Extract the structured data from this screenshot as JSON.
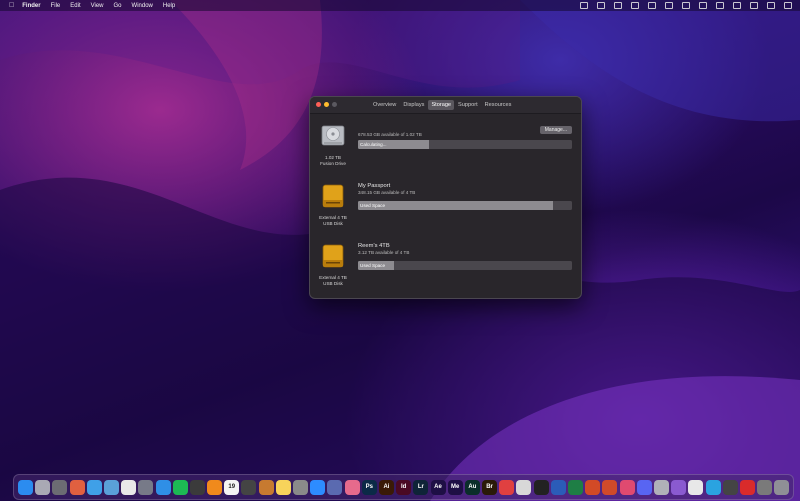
{
  "menubar": {
    "apple_icon": "apple-logo-icon",
    "items": [
      "Finder",
      "File",
      "Edit",
      "View",
      "Go",
      "Window",
      "Help"
    ],
    "status_icons": [
      "wallet-icon",
      "fan-icon",
      "vpn-icon",
      "gamepad-icon",
      "headphones-icon",
      "display-icon",
      "user-icon",
      "search-icon",
      "bluetooth-icon",
      "wifi-icon",
      "spotlight-icon",
      "control-center-icon",
      "siri-icon"
    ]
  },
  "window": {
    "tabs": [
      "Overview",
      "Displays",
      "Storage",
      "Support",
      "Resources"
    ],
    "active_tab": "Storage",
    "manage_label": "Manage...",
    "drives": [
      {
        "name": "",
        "availability": "678.53 GB available of 1.02 TB",
        "bar_label": "Calculating...",
        "used_fraction": 0.33,
        "caption_line1": "1.02 TB",
        "caption_line2": "Fusion Drive",
        "icon": "internal-drive-icon"
      },
      {
        "name": "My Passport",
        "availability": "348.15 GB available of 4 TB",
        "bar_label": "Used Space",
        "used_fraction": 0.91,
        "caption_line1": "External 4 TB",
        "caption_line2": "USB Disk",
        "icon": "external-drive-icon"
      },
      {
        "name": "Reem's 4TB",
        "availability": "3.12 TB available of 4 TB",
        "bar_label": "Used Space",
        "used_fraction": 0.17,
        "caption_line1": "External 4 TB",
        "caption_line2": "USB Disk",
        "icon": "external-drive-icon"
      }
    ]
  },
  "dock": {
    "apps": [
      {
        "name": "finder-icon",
        "label": "",
        "color": "#2b8cf0"
      },
      {
        "name": "launchpad-icon",
        "label": "",
        "color": "#a9a9b4"
      },
      {
        "name": "system-prefs-icon",
        "label": "",
        "color": "#6c6c73"
      },
      {
        "name": "app-store-icon",
        "label": "",
        "color": "#e06040"
      },
      {
        "name": "app-icon-5",
        "label": "",
        "color": "#3fa0e8"
      },
      {
        "name": "app-icon-6",
        "label": "",
        "color": "#5aa0d8"
      },
      {
        "name": "chrome-icon",
        "label": "",
        "color": "#e8e8e8"
      },
      {
        "name": "app-icon-8",
        "label": "",
        "color": "#777a88"
      },
      {
        "name": "safari-icon",
        "label": "",
        "color": "#2f8fe6"
      },
      {
        "name": "spotify-icon",
        "label": "",
        "color": "#1db954"
      },
      {
        "name": "app-icon-11",
        "label": "",
        "color": "#3b3b3b"
      },
      {
        "name": "vlc-icon",
        "label": "",
        "color": "#f08a1c"
      },
      {
        "name": "calendar-icon",
        "label": "19",
        "color": "#f4f4f4"
      },
      {
        "name": "app-icon-14",
        "label": "",
        "color": "#444444"
      },
      {
        "name": "app-icon-15",
        "label": "",
        "color": "#c77a30"
      },
      {
        "name": "notes-icon",
        "label": "",
        "color": "#f7d35b"
      },
      {
        "name": "app-icon-17",
        "label": "",
        "color": "#8a8a8a"
      },
      {
        "name": "zoom-icon",
        "label": "",
        "color": "#2d8cff"
      },
      {
        "name": "app-icon-19",
        "label": "",
        "color": "#5a6ab0"
      },
      {
        "name": "app-icon-20",
        "label": "",
        "color": "#e66a8c"
      },
      {
        "name": "photoshop-icon",
        "label": "Ps",
        "color": "#0b2a47"
      },
      {
        "name": "illustrator-icon",
        "label": "Ai",
        "color": "#3a1a06"
      },
      {
        "name": "indesign-icon",
        "label": "Id",
        "color": "#4a0a24"
      },
      {
        "name": "lightroom-icon",
        "label": "Lr",
        "color": "#0f2438"
      },
      {
        "name": "after-effects-icon",
        "label": "Ae",
        "color": "#1e0f45"
      },
      {
        "name": "media-encoder-icon",
        "label": "Me",
        "color": "#1e0f45"
      },
      {
        "name": "audition-icon",
        "label": "Au",
        "color": "#0a2e2a"
      },
      {
        "name": "bridge-icon",
        "label": "Br",
        "color": "#2a1a08"
      },
      {
        "name": "app-icon-29",
        "label": "",
        "color": "#e04040"
      },
      {
        "name": "app-icon-30",
        "label": "",
        "color": "#d8d8d8"
      },
      {
        "name": "capcut-icon",
        "label": "",
        "color": "#222222"
      },
      {
        "name": "word-icon",
        "label": "",
        "color": "#2b5cb8"
      },
      {
        "name": "excel-icon",
        "label": "",
        "color": "#1e7e45"
      },
      {
        "name": "powerpoint-icon",
        "label": "",
        "color": "#d24a26"
      },
      {
        "name": "app-icon-35",
        "label": "",
        "color": "#d04a2a"
      },
      {
        "name": "app-icon-36",
        "label": "",
        "color": "#e04a70"
      },
      {
        "name": "discord-icon",
        "label": "",
        "color": "#5865f2"
      },
      {
        "name": "app-icon-38",
        "label": "",
        "color": "#b0b0b8"
      },
      {
        "name": "app-icon-39",
        "label": "",
        "color": "#8a5ad0"
      },
      {
        "name": "slack-icon",
        "label": "",
        "color": "#e8e8e8"
      },
      {
        "name": "telegram-icon",
        "label": "",
        "color": "#2aa3e0"
      },
      {
        "name": "app-icon-42",
        "label": "",
        "color": "#444444"
      },
      {
        "name": "acrobat-icon",
        "label": "",
        "color": "#d92b2b"
      },
      {
        "name": "app-icon-44",
        "label": "",
        "color": "#7a7a7a"
      },
      {
        "name": "trash-icon",
        "label": "",
        "color": "#8f8f96"
      }
    ]
  }
}
